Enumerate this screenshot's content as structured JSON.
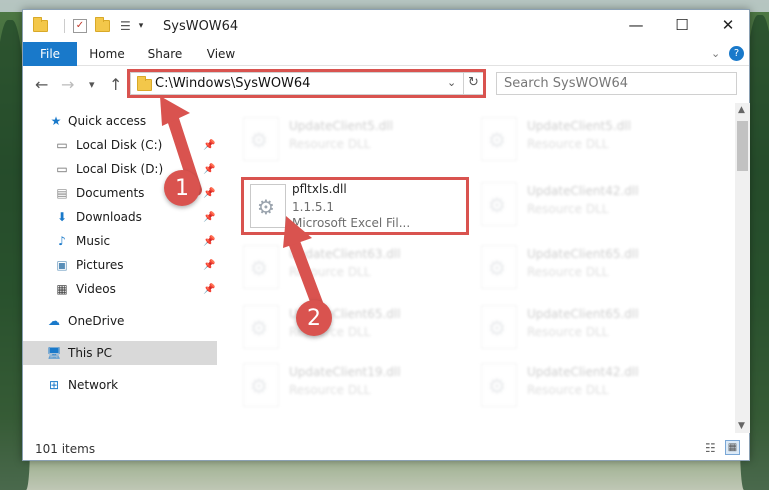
{
  "window": {
    "title": "SysWOW64",
    "minimize": "—",
    "maximize": "☐",
    "close": "✕"
  },
  "ribbon": {
    "tabs": [
      "File",
      "Home",
      "Share",
      "View"
    ],
    "expand_icon": "chevron-down-icon",
    "help_icon": "help-icon"
  },
  "navigation": {
    "back": "←",
    "forward": "→",
    "recent": "▾",
    "up": "↑",
    "address": "C:\\Windows\\SysWOW64",
    "search_placeholder": "Search SysWOW64"
  },
  "sidebar": {
    "items": [
      {
        "label": "Quick access",
        "icon": "star-icon",
        "pinned": false
      },
      {
        "label": "Local Disk (C:)",
        "icon": "drive-icon",
        "pinned": true
      },
      {
        "label": "Local Disk (D:)",
        "icon": "drive-icon",
        "pinned": true
      },
      {
        "label": "Documents",
        "icon": "documents-icon",
        "pinned": true
      },
      {
        "label": "Downloads",
        "icon": "download-icon",
        "pinned": true
      },
      {
        "label": "Music",
        "icon": "music-icon",
        "pinned": true
      },
      {
        "label": "Pictures",
        "icon": "pictures-icon",
        "pinned": true
      },
      {
        "label": "Videos",
        "icon": "videos-icon",
        "pinned": true
      },
      {
        "label": "OneDrive",
        "icon": "cloud-icon",
        "pinned": false
      },
      {
        "label": "This PC",
        "icon": "computer-icon",
        "pinned": false,
        "selected": true
      },
      {
        "label": "Network",
        "icon": "network-icon",
        "pinned": false
      }
    ]
  },
  "files": {
    "highlighted": {
      "name": "pfltxls.dll",
      "version": "1.1.5.1",
      "description": "Microsoft Excel Fil..."
    },
    "ghost": [
      {
        "name": "UpdateClient5.dll",
        "type": "Resource DLL"
      },
      {
        "name": "UpdateClient5.dll",
        "type": "Resource DLL"
      },
      {
        "name": "UpdateClient42.dll",
        "type": "Resource DLL"
      },
      {
        "name": "UpdateClient63.dll",
        "type": "Resource DLL"
      },
      {
        "name": "UpdateClient65.dll",
        "type": "Resource DLL"
      },
      {
        "name": "UpdateClient65.dll",
        "type": "Resource DLL"
      },
      {
        "name": "UpdateClient65.dll",
        "type": "Resource DLL"
      },
      {
        "name": "UpdateClient19.dll",
        "type": "Resource DLL"
      },
      {
        "name": "UpdateClient42.dll",
        "type": "Resource DLL"
      }
    ]
  },
  "status": {
    "item_count": "101 items"
  },
  "annotations": {
    "step1": "1",
    "step2": "2",
    "color": "#d9534f"
  }
}
